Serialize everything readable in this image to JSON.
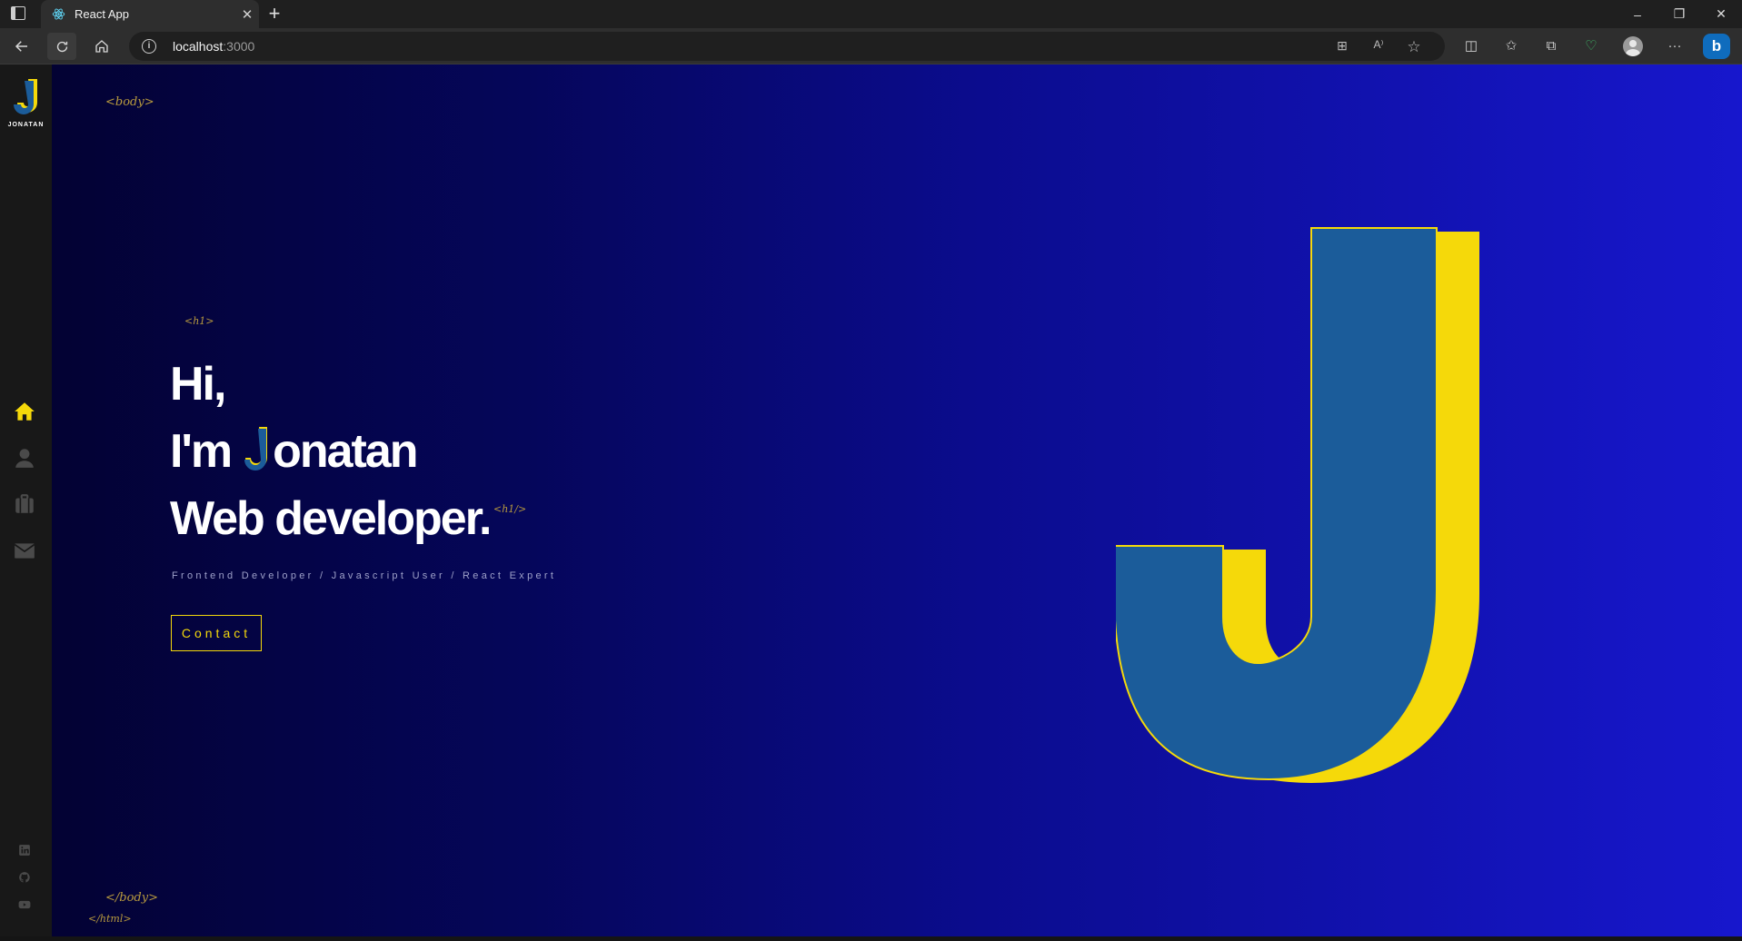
{
  "browser": {
    "tab_title": "React App",
    "tab_close": "✕",
    "new_tab": "+",
    "url_host": "localhost",
    "url_port": ":3000",
    "window_controls": {
      "minimize": "–",
      "restore": "❐",
      "close": "✕"
    },
    "more_label": "···"
  },
  "sidebar": {
    "logo_letter": "J",
    "logo_text": "JONATAN",
    "nav_items": [
      "home-icon",
      "user-icon",
      "briefcase-icon",
      "envelope-icon"
    ],
    "active_color": "#f5d90a",
    "social_icons": [
      "linkedin-icon",
      "github-icon",
      "youtube-icon"
    ]
  },
  "hero": {
    "tag_body_open": "<body>",
    "tag_h1_open": "<h1>",
    "line1": "Hi,",
    "line2_prefix": "I'm",
    "name_rest": "onatan",
    "line3": "Web developer.",
    "tag_h1_close": "<h1/>",
    "subtitle": "Frontend Developer / Javascript User / React Expert",
    "contact_label": "Contact",
    "tag_body_close": "</body>",
    "tag_html_close": "</html>"
  },
  "colors": {
    "accent_yellow": "#f5d90a",
    "j_blue": "#1b5c9a",
    "tag_gold": "#b89a3e"
  }
}
